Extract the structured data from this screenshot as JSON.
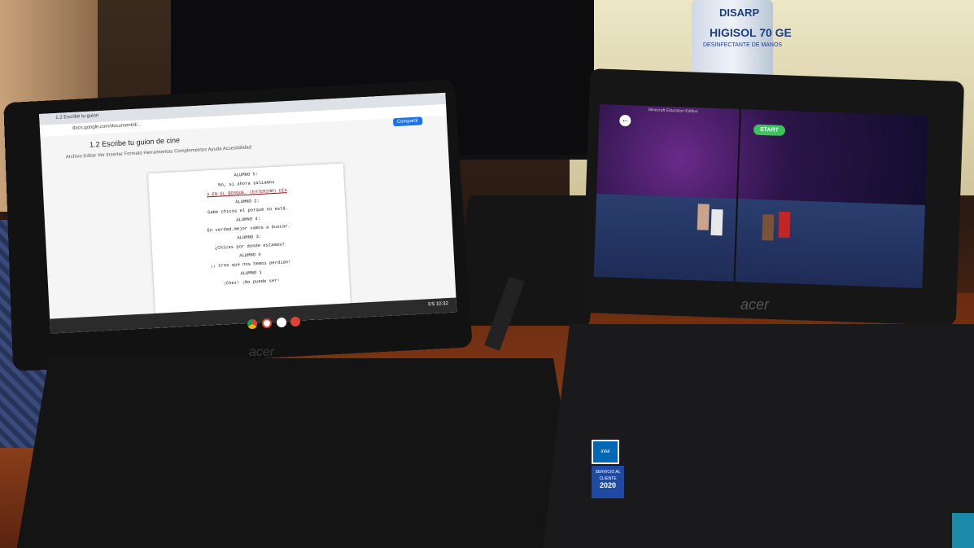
{
  "bottle": {
    "brand": "DISARP",
    "name": "HIGISOL 70 GE",
    "sub": "DESINFECTANTE DE MANOS"
  },
  "left_laptop": {
    "brand": "acer",
    "browser_tab": "1.2 Escribe tu guion",
    "url": "docs.google.com/document/d/...",
    "share_button": "Compartir",
    "doc_title": "1.2 Escribe tu guion de cine",
    "menu": "Archivo  Editar  Ver  Insertar  Formato  Herramientas  Complementos  Ayuda  Accesibilidad",
    "script_lines": [
      "ALUMNO 5:",
      "No, si ahora saliamos",
      "4.EN EL BOSQUE. (EXTERIOR) DÍA",
      "ALUMNO 2:",
      "Sabe chicos el porqué no está.",
      "ALUMNO 4:",
      "En verdad.mejor vamos a buscar.",
      "ALUMNO 3:",
      "¿Chicas por donde estamos?",
      "ALUMNO 4",
      "¡¡ Creo que nos hemos perdido!",
      "ALUMNO 1",
      "¡Chez! ¡No puede ser!"
    ],
    "clock": "ES 10:32"
  },
  "right_laptop": {
    "brand": "acer",
    "header": "Minecraft Education Edition",
    "start_button": "START",
    "stickers": {
      "intel": "intel",
      "service": "SERVICIO AL CLIENTE",
      "year": "2020"
    }
  },
  "colors": {
    "share_blue": "#1a73e8",
    "start_green": "#3bc45b",
    "desk": "#8a3e1a"
  },
  "icons": [
    "back-arrow-icon",
    "chrome-icon",
    "gmail-icon",
    "play-store-icon",
    "docs-icon"
  ]
}
